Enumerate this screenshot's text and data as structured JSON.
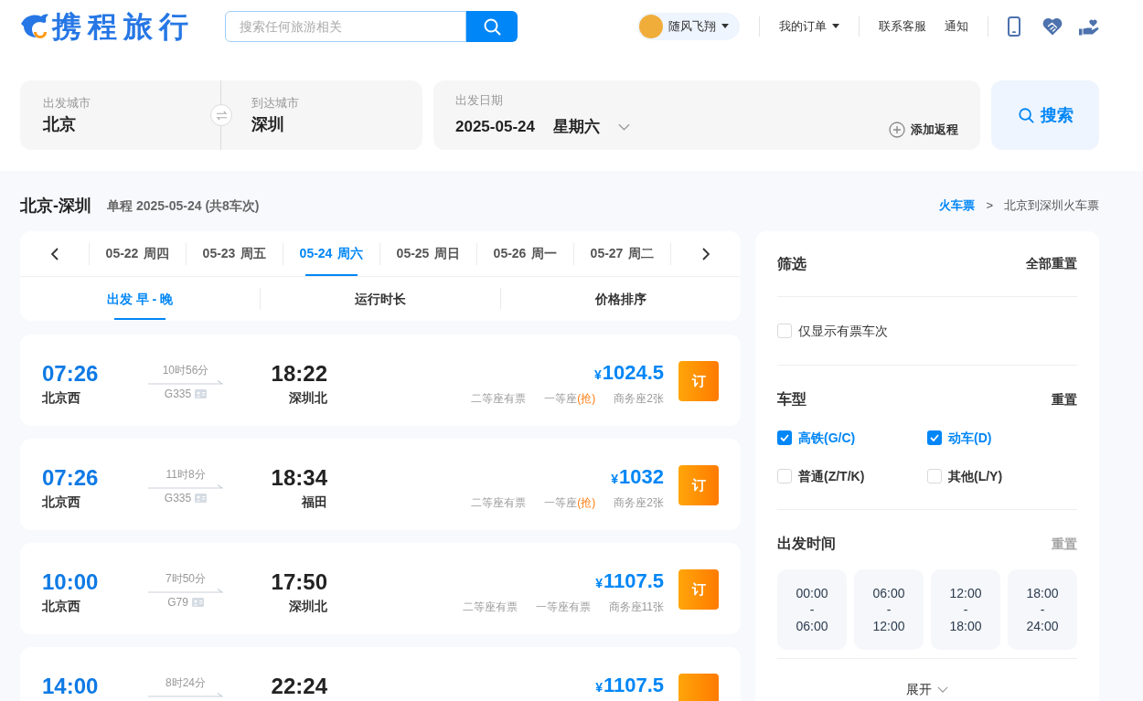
{
  "header": {
    "logo": "携程旅行",
    "search": {
      "placeholder": "搜索任何旅游相关"
    },
    "user": {
      "name": "随风飞翔"
    },
    "nav": [
      {
        "label": "我的订单",
        "kind": "dropdown"
      },
      {
        "label": "联系客服",
        "kind": "link"
      },
      {
        "label": "通知",
        "kind": "link"
      }
    ]
  },
  "search_form": {
    "from": {
      "label": "出发城市",
      "value": "北京"
    },
    "to": {
      "label": "到达城市",
      "value": "深圳"
    },
    "date": {
      "label": "出发日期",
      "value": "2025-05-24",
      "weekday": "星期六"
    },
    "add_return": "添加返程",
    "search_button": "搜索"
  },
  "route": {
    "title": "北京-深圳",
    "summary": "单程 2025-05-24 (共8车次)"
  },
  "breadcrumb": [
    {
      "label": "火车票",
      "kind": "link"
    },
    {
      "label": ">",
      "kind": "separator"
    },
    {
      "label": "北京到深圳火车票",
      "kind": "current"
    }
  ],
  "date_tabs": [
    {
      "date": "05-22",
      "weekday": "周四",
      "selected": false
    },
    {
      "date": "05-23",
      "weekday": "周五",
      "selected": false
    },
    {
      "date": "05-24",
      "weekday": "周六",
      "selected": true
    },
    {
      "date": "05-25",
      "weekday": "周日",
      "selected": false
    },
    {
      "date": "05-26",
      "weekday": "周一",
      "selected": false
    },
    {
      "date": "05-27",
      "weekday": "周二",
      "selected": false
    }
  ],
  "sort_tabs": [
    {
      "label": "出发 早 - 晚",
      "selected": true
    },
    {
      "label": "运行时长",
      "selected": false
    },
    {
      "label": "价格排序",
      "selected": false
    }
  ],
  "trains": [
    {
      "depart_time": "07:26",
      "depart_station": "北京西",
      "duration": "10时56分",
      "number": "G335",
      "arrive_time": "18:22",
      "arrive_station": "深圳北",
      "currency": "¥",
      "price": "1024.5",
      "seats": [
        {
          "label": "二等座有票"
        },
        {
          "label": "一等座",
          "note": "(抢)"
        },
        {
          "label": "商务座2张"
        }
      ],
      "book": "订"
    },
    {
      "depart_time": "07:26",
      "depart_station": "北京西",
      "duration": "11时8分",
      "number": "G335",
      "arrive_time": "18:34",
      "arrive_station": "福田",
      "currency": "¥",
      "price": "1032",
      "seats": [
        {
          "label": "二等座有票"
        },
        {
          "label": "一等座",
          "note": "(抢)"
        },
        {
          "label": "商务座2张"
        }
      ],
      "book": "订"
    },
    {
      "depart_time": "10:00",
      "depart_station": "北京西",
      "duration": "7时50分",
      "number": "G79",
      "arrive_time": "17:50",
      "arrive_station": "深圳北",
      "currency": "¥",
      "price": "1107.5",
      "seats": [
        {
          "label": "二等座有票"
        },
        {
          "label": "一等座有票"
        },
        {
          "label": "商务座11张"
        }
      ],
      "book": "订"
    },
    {
      "depart_time": "14:00",
      "duration": "8时24分",
      "arrive_time": "22:24",
      "currency": "¥",
      "price": "1107.5"
    }
  ],
  "filter": {
    "title": "筛选",
    "reset_all": "全部重置",
    "available_only": {
      "label": "仅显示有票车次",
      "checked": false
    },
    "train_types": {
      "title": "车型",
      "reset": {
        "label": "重置",
        "disabled": false
      },
      "options": [
        {
          "label": "高铁(G/C)",
          "checked": true
        },
        {
          "label": "动车(D)",
          "checked": true
        },
        {
          "label": "普通(Z/T/K)",
          "checked": false
        },
        {
          "label": "其他(L/Y)",
          "checked": false
        }
      ]
    },
    "depart_time": {
      "title": "出发时间",
      "reset": {
        "label": "重置",
        "disabled": true
      },
      "slots": [
        {
          "label": "00:00\n-\n06:00",
          "selected": false
        },
        {
          "label": "06:00\n-\n12:00",
          "selected": false
        },
        {
          "label": "12:00\n-\n18:00",
          "selected": false
        },
        {
          "label": "18:00\n-\n24:00",
          "selected": false
        }
      ]
    },
    "expand": "展开"
  }
}
